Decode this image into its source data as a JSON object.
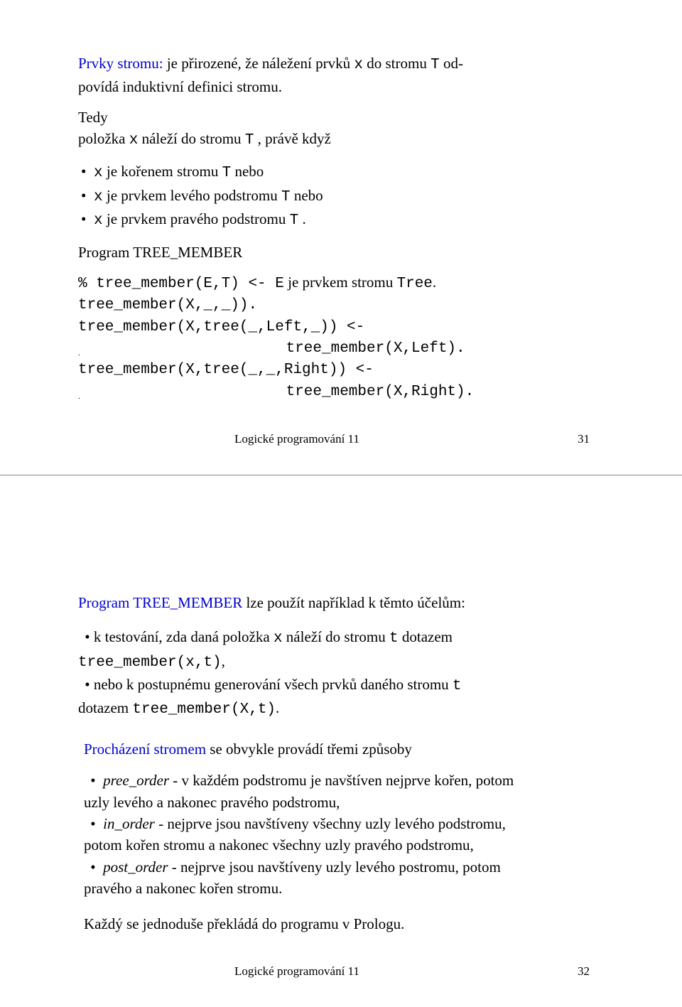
{
  "slide1": {
    "p1_lead": "Prvky stromu:",
    "p1_rest_a": " je přirozené, že náležení prvků ",
    "p1_code1": "x",
    "p1_rest_b": " do stromu  ",
    "p1_code2": "T",
    "p1_rest_c": " od-",
    "p1_line2": "povídá induktivní definici stromu.",
    "p2_a": "Tedy",
    "p2_b_a": "položka ",
    "p2_b_code1": "x",
    "p2_b_b": " náleží do stromu ",
    "p2_b_code2": "T",
    "p2_b_c": " , právě když",
    "b1_code1": "x",
    "b1_txt1": " je kořenem stromu ",
    "b1_code2": "T",
    "b1_txt2": " nebo",
    "b2_code1": "x",
    "b2_txt1": " je prvkem  levého podstromu ",
    "b2_code2": "T",
    "b2_txt2": " nebo",
    "b3_code1": "x",
    "b3_txt1": " je prvkem  pravého podstromu ",
    "b3_code2": "T",
    "b3_txt2": " .",
    "prog_title": "Program TREE_MEMBER",
    "code1_a": "% tree_member(E,T) <-  ",
    "code1_b": "E",
    "code1_c": " je prvkem stromu ",
    "code1_d": "Tree",
    "code1_e": ".",
    "code2": "tree_member(X,_,_)).",
    "code3": "tree_member(X,tree(_,Left,_)) <-",
    "code4_a": ".",
    "code4_b": "                       tree_member(X,Left).",
    "code5": "tree_member(X,tree(_,_,Right)) <-",
    "code6_a": ".",
    "code6_b": "                       tree_member(X,Right).",
    "footer_center": "Logické programování 11",
    "footer_page": "31"
  },
  "slide2": {
    "p1_lead": "Program TREE_MEMBER",
    "p1_rest": " lze použít například k těmto účelům:",
    "b1_a": " k testování, zda daná položka ",
    "b1_code1": "x",
    "b1_b": "  náleží do stromu  ",
    "b1_code2": "t",
    "b1_c": " dotazem",
    "b1_line2": "tree_member(x,t)",
    "b1_line2_tail": ",",
    "b2_a": " nebo k postupnému generování všech prvků daného stromu  ",
    "b2_code1": "t",
    "b2_line2_a": "dotazem  ",
    "b2_line2_b": "tree_member(X,t)",
    "b2_line2_c": ".",
    "p2_lead": "Procházení stromem",
    "p2_rest": " se obvykle provádí třemi způsoby",
    "b3_it": "pree_order",
    "b3_txt_a": "  - v každém podstromu je navštíven nejprve kořen, potom",
    "b3_line2": "uzly levého a nakonec pravého podstromu,",
    "b4_it": "in_order",
    "b4_txt_a": "  -  nejprve jsou navštíveny všechny uzly levého podstromu,",
    "b4_line2": "potom kořen stromu a nakonec všechny uzly pravého podstromu,",
    "b5_it": "post_order",
    "b5_txt_a": " -  nejprve jsou navštíveny uzly levého postromu, potom",
    "b5_line2": "pravého a nakonec kořen stromu.",
    "p3": "Každý se jednoduše překládá do programu v Prologu.",
    "footer_center": "Logické programování 11",
    "footer_page": "32"
  }
}
